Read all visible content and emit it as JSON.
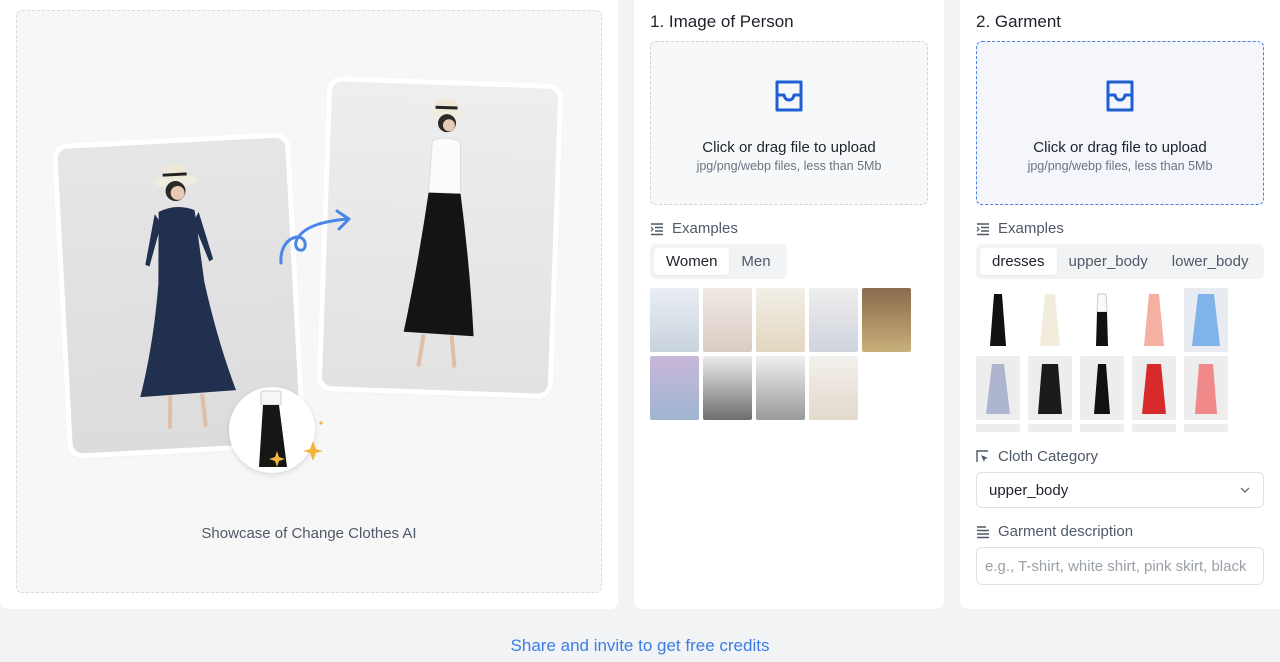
{
  "showcase": {
    "caption": "Showcase of Change Clothes AI"
  },
  "person": {
    "title": "1. Image of Person",
    "upload_main": "Click or drag file to upload",
    "upload_sub": "jpg/png/webp files, less than 5Mb",
    "examples_label": "Examples",
    "tabs": [
      {
        "label": "Women",
        "selected": true
      },
      {
        "label": "Men",
        "selected": false
      }
    ]
  },
  "garment": {
    "title": "2. Garment",
    "upload_main": "Click or drag file to upload",
    "upload_sub": "jpg/png/webp files, less than 5Mb",
    "examples_label": "Examples",
    "tabs": [
      {
        "label": "dresses",
        "selected": true
      },
      {
        "label": "upper_body",
        "selected": false
      },
      {
        "label": "lower_body",
        "selected": false
      }
    ],
    "cloth_category_label": "Cloth Category",
    "cloth_category_value": "upper_body",
    "description_label": "Garment description",
    "description_placeholder": "e.g., T-shirt, white shirt, pink skirt, black"
  },
  "footer": {
    "share_link": "Share and invite to get free credits"
  },
  "colors": {
    "accent": "#3c7ee6",
    "icon_blue": "#1f5fd6"
  },
  "icons": [
    "upload-inbox-icon",
    "list-icon",
    "chevron-down-icon",
    "sparkle-icon",
    "curved-arrow-icon"
  ]
}
